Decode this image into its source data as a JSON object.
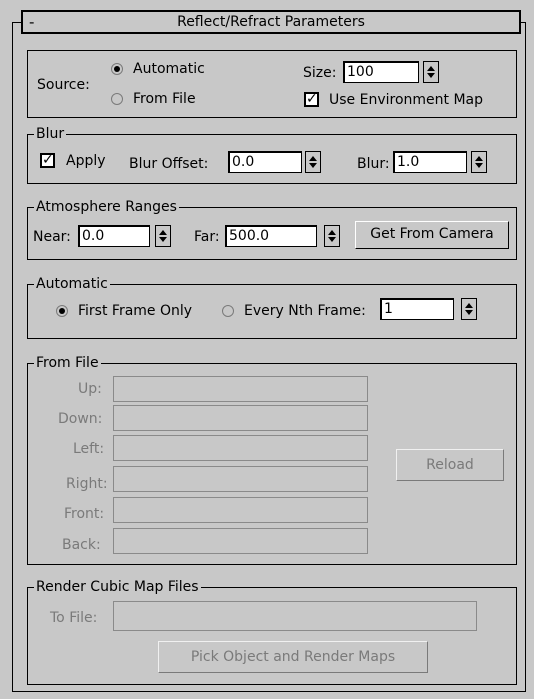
{
  "rollout": {
    "toggle": "-",
    "title": "Reflect/Refract Parameters"
  },
  "source": {
    "label": "Source:",
    "options": [
      {
        "label": "Automatic",
        "selected": true
      },
      {
        "label": "From File",
        "selected": false
      }
    ],
    "size_label": "Size:",
    "size_value": "100",
    "use_env_map": {
      "label": "Use Environment Map",
      "checked": true
    }
  },
  "blur": {
    "group_label": "Blur",
    "apply": {
      "label": "Apply",
      "checked": true
    },
    "offset_label": "Blur Offset:",
    "offset_value": "0.0",
    "blur_label": "Blur:",
    "blur_value": "1.0"
  },
  "atmosphere": {
    "group_label": "Atmosphere Ranges",
    "near_label": "Near:",
    "near_value": "0.0",
    "far_label": "Far:",
    "far_value": "500.0",
    "get_camera_label": "Get From Camera"
  },
  "automatic": {
    "group_label": "Automatic",
    "first_frame": {
      "label": "First Frame Only",
      "selected": true
    },
    "every_nth": {
      "label": "Every Nth Frame:",
      "selected": false
    },
    "nth_value": "1"
  },
  "from_file": {
    "group_label": "From File",
    "fields": [
      "Up:",
      "Down:",
      "Left:",
      "Right:",
      "Front:",
      "Back:"
    ],
    "reload_label": "Reload"
  },
  "render_cubic": {
    "group_label": "Render Cubic Map Files",
    "to_file_label": "To File:",
    "pick_label": "Pick Object and Render Maps"
  }
}
